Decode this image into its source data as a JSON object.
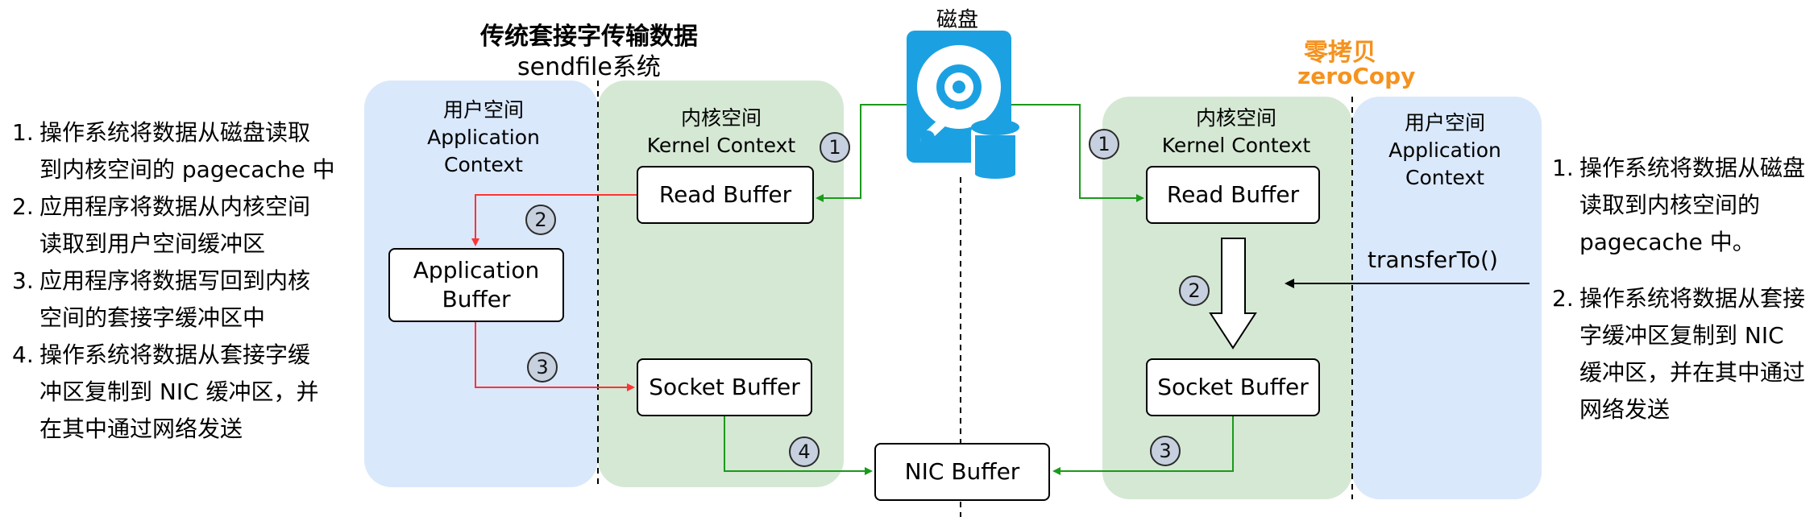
{
  "left_title": "传统套接字传输数据",
  "left_subtitle": "sendfile系统",
  "disk_label": "磁盘",
  "right_title": "零拷贝",
  "right_subtitle": "zeroCopy",
  "left_user_space": {
    "cn": "用户空间",
    "en1": "Application",
    "en2": "Context"
  },
  "left_kernel_space": {
    "cn": "内核空间",
    "en": "Kernel Context"
  },
  "right_kernel_space": {
    "cn": "内核空间",
    "en": "Kernel Context"
  },
  "right_user_space": {
    "cn": "用户空间",
    "en1": "Application",
    "en2": "Context"
  },
  "boxes": {
    "left_read_buffer": "Read Buffer",
    "app_buffer_line1": "Application",
    "app_buffer_line2": "Buffer",
    "left_socket_buffer": "Socket Buffer",
    "nic_buffer": "NIC Buffer",
    "right_read_buffer": "Read Buffer",
    "right_socket_buffer": "Socket Buffer"
  },
  "transfer_label": "transferTo()",
  "badges": {
    "l1": "1",
    "l2": "2",
    "l3": "3",
    "l4": "4",
    "r1": "1",
    "r2": "2",
    "r3": "3"
  },
  "left_steps": [
    {
      "num": "1.",
      "lines": [
        "操作系统将数据从磁盘读取",
        "到内核空间的 pagecache 中"
      ]
    },
    {
      "num": "2.",
      "lines": [
        "应用程序将数据从内核空间",
        "读取到用户空间缓冲区"
      ]
    },
    {
      "num": "3.",
      "lines": [
        "应用程序将数据写回到内核",
        "空间的套接字缓冲区中"
      ]
    },
    {
      "num": "4.",
      "lines": [
        "操作系统将数据从套接字缓",
        "冲区复制到 NIC 缓冲区，并",
        "在其中通过网络发送"
      ]
    }
  ],
  "right_steps": [
    {
      "num": "1.",
      "lines": [
        "操作系统将数据从磁盘",
        "读取到内核空间的",
        "pagecache 中。"
      ]
    },
    {
      "num": "2.",
      "lines": [
        "操作系统将数据从套接",
        "字缓冲区复制到 NIC",
        "缓冲区，并在其中通过",
        "网络发送"
      ]
    }
  ],
  "colors": {
    "user_space_bg": "#dae8fc",
    "kernel_space_bg": "#d5e8d4",
    "green_arrow": "#1a9a1a",
    "red_arrow": "#ff3333",
    "orange_title": "#f5921e",
    "disk_blue": "#1ba1e2",
    "badge_fill": "#c6d0de"
  }
}
